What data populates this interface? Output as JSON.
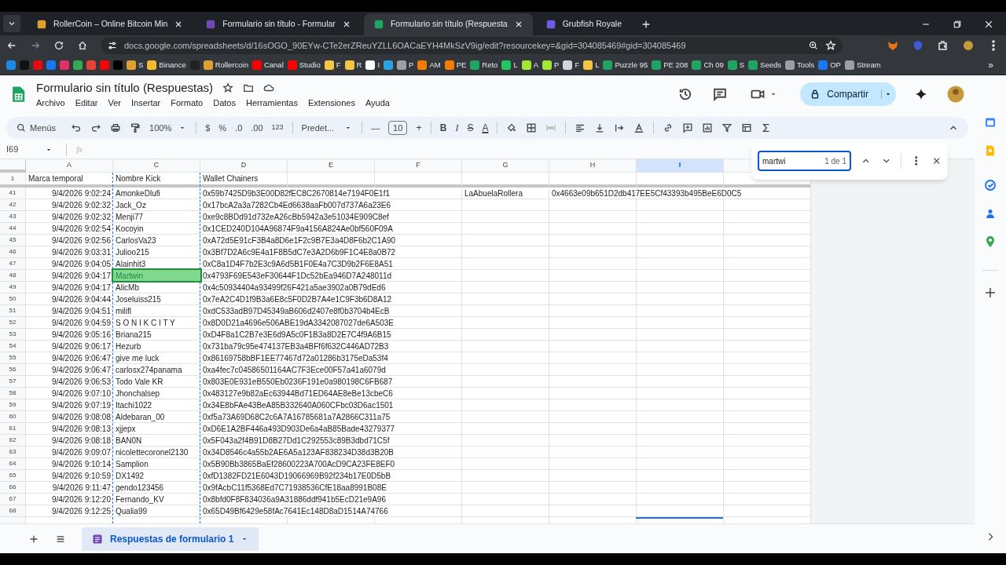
{
  "browser": {
    "tabs": [
      {
        "title": "RollerCoin – Online Bitcoin Min",
        "color": "#e0a030",
        "selected": false
      },
      {
        "title": "Formulario sin título - Formular",
        "color": "#7248b9",
        "selected": false
      },
      {
        "title": "Formulario sin título (Respuesta",
        "color": "#1fa463",
        "selected": true
      },
      {
        "title": "Grubfish Royale",
        "color": "#6c5ce7",
        "selected": false
      }
    ],
    "url": "docs.google.com/spreadsheets/d/16sOGO_90EYw-CTe2erZReuYZLL6OACaEYH4MkSzV9ig/edit?resourcekey=&gid=304085469#gid=304085469",
    "bookmarks": [
      {
        "color": "#1e88e5"
      },
      {
        "color": "#111111"
      },
      {
        "color": "#e50914"
      },
      {
        "color": "#1877f2"
      },
      {
        "color": "#e1306c"
      },
      {
        "color": "#34a853"
      },
      {
        "color": "#ea4335"
      },
      {
        "color": "#ff0000"
      },
      {
        "color": "#000000"
      },
      {
        "color": "#e0a030",
        "label": "S"
      },
      {
        "color": "#f3ba2f",
        "label": "Binance"
      },
      {
        "color": "#222222"
      },
      {
        "color": "#e0a030",
        "label": "Rollercoin"
      },
      {
        "color": "#ff0000",
        "label": "Canal"
      },
      {
        "color": "#ff0000",
        "label": "Studio"
      },
      {
        "color": "#f5c542",
        "label": "F"
      },
      {
        "color": "#f5c542",
        "label": "R"
      },
      {
        "color": "#ffffff",
        "label": "I"
      },
      {
        "color": "#2aa3e0"
      },
      {
        "color": "#9aa0a6",
        "label": "P"
      },
      {
        "color": "#f57c00",
        "label": "AM"
      },
      {
        "color": "#f57c00",
        "label": "PE"
      },
      {
        "color": "#1fa463",
        "label": "Reto"
      },
      {
        "color": "#22c55e",
        "label": "L"
      },
      {
        "color": "#a3e635",
        "label": "A"
      },
      {
        "color": "#a3e635",
        "label": "P"
      },
      {
        "color": "#d1d5db",
        "label": "F"
      },
      {
        "color": "#f5c542",
        "label": "L"
      },
      {
        "color": "#1fa463",
        "label": "Puzzle 95"
      },
      {
        "color": "#1fa463",
        "label": "PE 208"
      },
      {
        "color": "#1fa463",
        "label": "Ch 09"
      },
      {
        "color": "#1fa463",
        "label": "S"
      },
      {
        "color": "#1fa463",
        "label": "Seeds"
      },
      {
        "color": "#9aa0a6",
        "label": "Tools"
      },
      {
        "color": "#1877f2",
        "label": "OP"
      },
      {
        "color": "#9aa0a6",
        "label": "Stream"
      }
    ],
    "more": "»"
  },
  "doc": {
    "title": "Formulario sin título (Respuestas)",
    "menu": [
      "Archivo",
      "Editar",
      "Ver",
      "Insertar",
      "Formato",
      "Datos",
      "Herramientas",
      "Extensiones",
      "Ayuda"
    ],
    "share": "Compartir"
  },
  "toolbar": {
    "search": "Menús",
    "zoom": "100%",
    "currency": "$",
    "percent": "%",
    "dec_less": ".0",
    "dec_more": ".00",
    "number_format": "123",
    "font": "Predet...",
    "font_size": "10",
    "minus": "—",
    "plus": "+",
    "bold": "B",
    "italic": "I",
    "strike": "S",
    "text_color": "A"
  },
  "formula_bar": {
    "cell": "I69",
    "fx": "fx"
  },
  "columns": [
    {
      "label": "A",
      "selected": false
    },
    {
      "label": "C",
      "selected": false
    },
    {
      "label": "D",
      "selected": false
    },
    {
      "label": "E",
      "selected": false
    },
    {
      "label": "F",
      "selected": false
    },
    {
      "label": "G",
      "selected": false
    },
    {
      "label": "H",
      "selected": false
    },
    {
      "label": "I",
      "selected": true
    }
  ],
  "header_row": {
    "number": "1",
    "cells": [
      "Marca temporal",
      "Nombre Kick",
      "Wallet Chainers"
    ]
  },
  "rows": [
    {
      "number": "41",
      "a": "9/4/2026 9:02:24",
      "c": "AmonkeDlufi",
      "d": "0x59b7425D9b3E00D82fEC8C2670814e7194F0E1f1",
      "g": "LaAbuelaRollera",
      "h": "0x4663e09b651D2db417EE5Cf43393b495BeE6D0C5",
      "match": false
    },
    {
      "number": "42",
      "a": "9/4/2026 9:02:32",
      "c": "Jack_Oz",
      "d": "0x17bcA2a3a7282Cb4Ed6638aaFb007d737A6a23E6",
      "match": false
    },
    {
      "number": "43",
      "a": "9/4/2026 9:02:32",
      "c": "Menji77",
      "d": "0xe9c8BDd91d732eA26cBb5942a3e51034E909C8ef",
      "match": false
    },
    {
      "number": "44",
      "a": "9/4/2026 9:02:54",
      "c": "Kocoyin",
      "d": "0x1CED240D104A96874F9a4156A824Ae0bf560F09A",
      "match": false
    },
    {
      "number": "45",
      "a": "9/4/2026 9:02:56",
      "c": "CarlosVa23",
      "d": "0xA72d5E91cF3B4a8D6e1F2c9B7E3a4D8F6b2C1A90",
      "match": false
    },
    {
      "number": "46",
      "a": "9/4/2026 9:03:31",
      "c": "Julioo215",
      "d": "0x3Bf7D2A6c9E4a1F8B5dC7e3A2D6b9F1C4E8a0B72",
      "match": false
    },
    {
      "number": "47",
      "a": "9/4/2026 9:04:05",
      "c": "Alainhit3",
      "d": "0xC8a1D4F7b2E3c9A6d5B1F0E4a7C3D9b2F6E8A51",
      "match": false
    },
    {
      "number": "48",
      "a": "9/4/2026 9:04:17",
      "c": "Martwin",
      "d": "0x4793F69E543eF30644F1Dc52bEa946D7A248011d",
      "match": true
    },
    {
      "number": "49",
      "a": "9/4/2026 9:04:17",
      "c": "AlicMb",
      "d": "0x4c50934404a93499f26F421a5ae3902a0B79dEd6",
      "match": false
    },
    {
      "number": "50",
      "a": "9/4/2026 9:04:44",
      "c": "Joseluiss215",
      "d": "0x7eA2C4D1f9B3a6E8c5F0D2B7A4e1C9F3b6D8A12",
      "match": false
    },
    {
      "number": "51",
      "a": "9/4/2026 9:04:51",
      "c": "milifl",
      "d": "0xdC533adB97D45349aB606d2407e8f0b3704b4EcB",
      "match": false
    },
    {
      "number": "52",
      "a": "9/4/2026 9:04:59",
      "c": "S O N I K C I T Y",
      "d": "0x8D0D21a4696e506ABE19dA3342087027de6A503E",
      "match": false
    },
    {
      "number": "53",
      "a": "9/4/2026 9:05:16",
      "c": "Briana215",
      "d": "0xD4F8a1C2B7e3E6d9A5c0F1B3a8D2E7C4f9A6B15",
      "match": false
    },
    {
      "number": "54",
      "a": "9/4/2026 9:06:17",
      "c": "Hezurb",
      "d": "0x731ba79c95e474137EB3a4BFf6f632C446AD72B3",
      "match": false
    },
    {
      "number": "55",
      "a": "9/4/2026 9:06:47",
      "c": "give me luck",
      "d": "0x86169758bBF1EE77467d72a01286b3175eDa53f4",
      "match": false
    },
    {
      "number": "56",
      "a": "9/4/2026 9:06:47",
      "c": "carlosx274panama",
      "d": "0xa4fec7c04586501164AC7F3Ece00F57a41a6079d",
      "match": false
    },
    {
      "number": "57",
      "a": "9/4/2026 9:06:53",
      "c": "Todo Vale KR",
      "d": "0x803E0E931eB550Eb0236F191e0a980198C6FB687",
      "match": false
    },
    {
      "number": "58",
      "a": "9/4/2026 9:07:10",
      "c": "Jhonchalsep",
      "d": "0x483127e9b82aEc63944Bd71ED64AE8eBe13cbeC6",
      "match": false
    },
    {
      "number": "59",
      "a": "9/4/2026 9:07:19",
      "c": "Itachi1022",
      "d": "0x34E8bFAe43BeA85B332640A060CFbc03D6ac1501",
      "match": false
    },
    {
      "number": "60",
      "a": "9/4/2026 9:08:08",
      "c": "Aldebaran_00",
      "d": "0xf5a73A69D68C2c6A7A16785681a7A2866C311a75",
      "match": false
    },
    {
      "number": "61",
      "a": "9/4/2026 9:08:13",
      "c": "xjjepx",
      "d": "0xD6E1A2BF446a493D903De6a4aB85Bade43279377",
      "match": false
    },
    {
      "number": "62",
      "a": "9/4/2026 9:08:18",
      "c": "BAN0N",
      "d": "0x5F043a2f4B91D8B27Dd1C292553c89B3dbd71C5f",
      "match": false
    },
    {
      "number": "63",
      "a": "9/4/2026 9:09:07",
      "c": "nicolettecoronel2130",
      "d": "0x34D8546c4a55b2AE6A5a123AF838234D38d3B20B",
      "match": false
    },
    {
      "number": "64",
      "a": "9/4/2026 9:10:14",
      "c": "Samplion",
      "d": "0x5B90Bb3865BaEf28600223A700AcD9CA23FE8EF0",
      "match": false
    },
    {
      "number": "65",
      "a": "9/4/2026 9:10:59",
      "c": "DX1492",
      "d": "0xfD1382FD21E6043D19066969B92f234b17E0D5bB",
      "match": false
    },
    {
      "number": "66",
      "a": "9/4/2026 9:11:47",
      "c": "gendo123456",
      "d": "0x9fAcbC11f5368Ed7C71938536CfE18aa8991B08E",
      "match": false
    },
    {
      "number": "67",
      "a": "9/4/2026 9:12:20",
      "c": "Fernando_KV",
      "d": "0x8bfd0F8F834036a9A31886ddf941b5EcD21e9A96",
      "match": false
    },
    {
      "number": "68",
      "a": "9/4/2026 9:12:25",
      "c": "Qualia99",
      "d": "0x65D49Bf6429e58fAc7641Ec148D8aD1514A74766",
      "match": false
    }
  ],
  "find": {
    "query": "martwi",
    "count": "1 de 1"
  },
  "sheet_tabs": [
    {
      "label": "Respuestas de formulario 1",
      "selected": true
    }
  ]
}
